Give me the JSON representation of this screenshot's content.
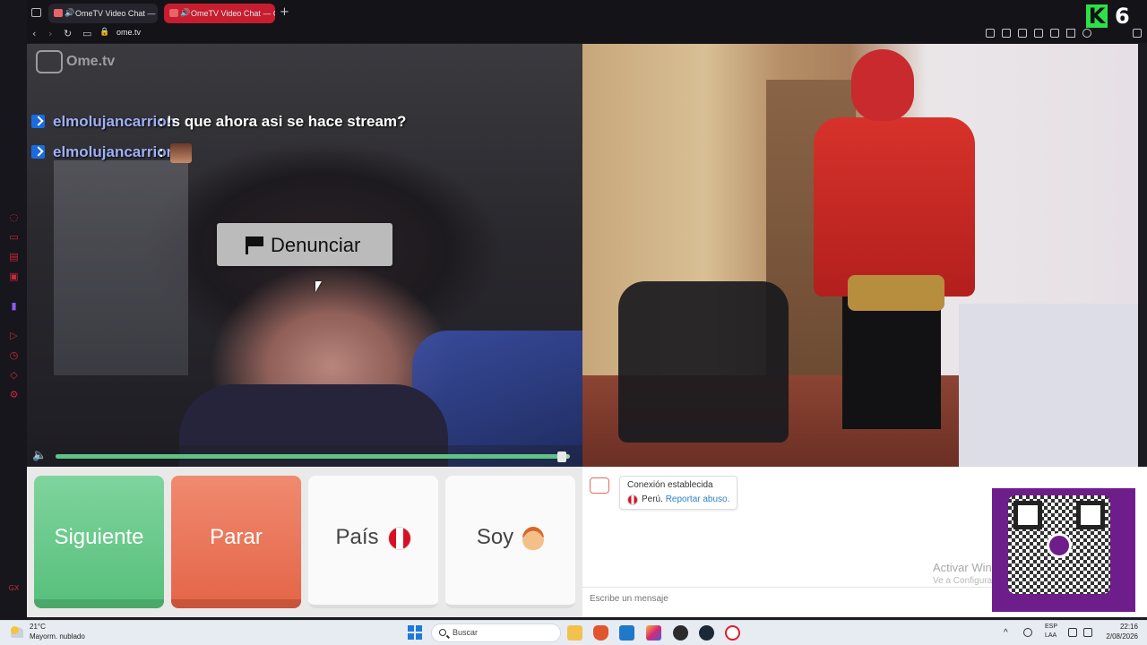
{
  "browser": {
    "tabs": [
      {
        "title": "OmeTV Video Chat — O",
        "active": false
      },
      {
        "title": "OmeTV Video Chat — O",
        "active": true
      }
    ],
    "url": "ome.tv",
    "accent": "#c71d2f"
  },
  "overlay": {
    "logo_k": "K",
    "logo_num": "6"
  },
  "video": {
    "watermark": "Ome.tv",
    "watermark_box": "Ome TV",
    "chat_overlay": [
      {
        "user": "elmolujancarrion",
        "sep": ":",
        "message": "!s que ahora asi se hace stream?"
      },
      {
        "user": "elmolujancarrion",
        "sep": ":",
        "message": ""
      }
    ],
    "report_label": "Denunciar",
    "volume_level": 0.99
  },
  "controls": {
    "next_label": "Siguiente",
    "stop_label": "Parar",
    "country_label": "País",
    "iam_label": "Soy",
    "next_color": "#59c07d",
    "stop_color": "#e5674a"
  },
  "chat": {
    "status_title": "Conexión establecida",
    "status_country": "Perú.",
    "report_link": "Reportar abuso.",
    "input_placeholder": "Escribe un mensaje",
    "activate_title": "Activar Win",
    "activate_sub": "Ve a Configura"
  },
  "taskbar": {
    "temperature": "21°C",
    "condition": "Mayorm. nublado",
    "search_label": "Buscar",
    "lang_line1": "ESP",
    "lang_line2": "LAA",
    "time": "22:16",
    "date": "2/08/2026"
  }
}
